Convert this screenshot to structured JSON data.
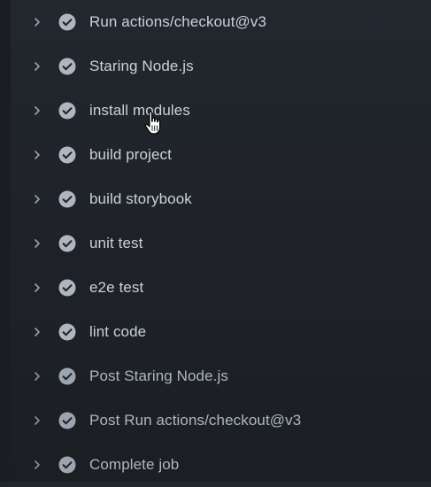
{
  "steps": [
    {
      "label": "Run actions/checkout@v3",
      "status": "success-icon"
    },
    {
      "label": "Staring Node.js",
      "status": "success-icon"
    },
    {
      "label": "install modules",
      "status": "success-icon"
    },
    {
      "label": "build project",
      "status": "success-icon"
    },
    {
      "label": "build storybook",
      "status": "success-icon"
    },
    {
      "label": "unit test",
      "status": "success-icon"
    },
    {
      "label": "e2e test",
      "status": "success-icon"
    },
    {
      "label": "lint code",
      "status": "success-icon"
    },
    {
      "label": "Post Staring Node.js",
      "status": "success-icon"
    },
    {
      "label": "Post Run actions/checkout@v3",
      "status": "success-icon"
    },
    {
      "label": "Complete job",
      "status": "success-icon"
    }
  ],
  "colors": {
    "background": "#1f2329",
    "text": "#c9d1d9",
    "icon": "#aeb6bf",
    "check_mark": "#1f2329"
  }
}
